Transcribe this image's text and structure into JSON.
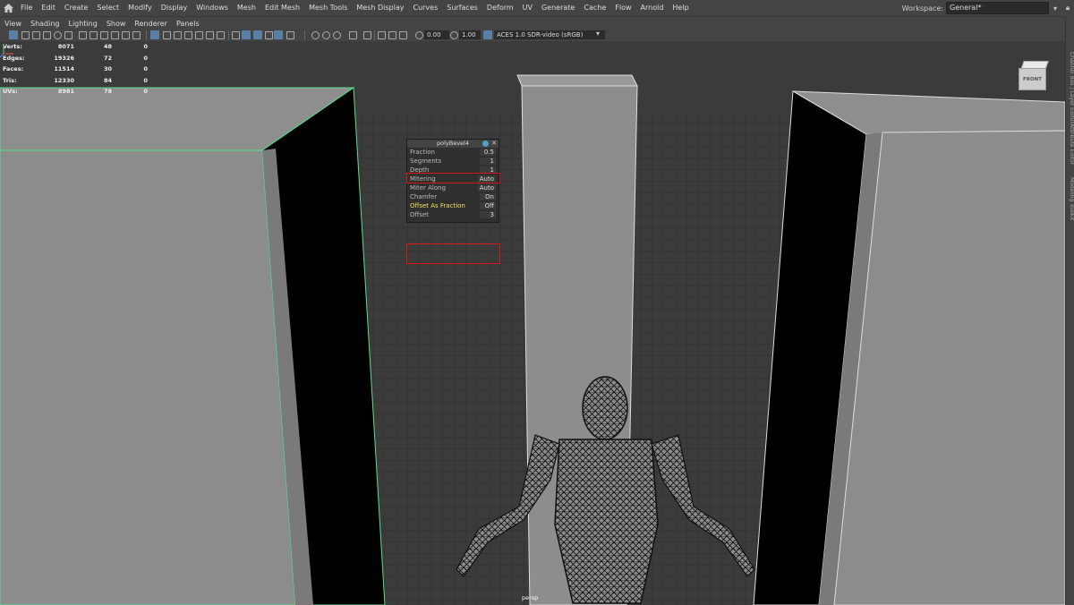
{
  "menubar": {
    "items": [
      "File",
      "Edit",
      "Create",
      "Select",
      "Modify",
      "Display",
      "Windows",
      "Mesh",
      "Edit Mesh",
      "Mesh Tools",
      "Mesh Display",
      "Curves",
      "Surfaces",
      "Deform",
      "UV",
      "Generate",
      "Cache",
      "Flow",
      "Arnold",
      "Help"
    ],
    "workspace_label": "Workspace:",
    "workspace_value": "General*"
  },
  "panel_menu": [
    "View",
    "Shading",
    "Lighting",
    "Show",
    "Renderer",
    "Panels"
  ],
  "toolbar": {
    "exposure": "0.00",
    "gamma": "1.00",
    "color_space": "ACES 1.0 SDR-video (sRGB)"
  },
  "hud": [
    {
      "label": "Verts:",
      "a": "8071",
      "b": "48",
      "c": "0"
    },
    {
      "label": "Edges:",
      "a": "19326",
      "b": "72",
      "c": "0"
    },
    {
      "label": "Faces:",
      "a": "11514",
      "b": "30",
      "c": "0"
    },
    {
      "label": "Tris:",
      "a": "12330",
      "b": "84",
      "c": "0"
    },
    {
      "label": "UVs:",
      "a": "8981",
      "b": "78",
      "c": "0"
    }
  ],
  "view_cube": {
    "face_label": "FRONT"
  },
  "camera_label": "persp",
  "popup": {
    "title": "polyBevel4",
    "rows": [
      {
        "label": "Fraction",
        "value": "0.5"
      },
      {
        "label": "Segments",
        "value": "1"
      },
      {
        "label": "Depth",
        "value": "1"
      },
      {
        "label": "Mitering",
        "value": "Auto"
      },
      {
        "label": "Miter Along",
        "value": "Auto"
      },
      {
        "label": "Chamfer",
        "value": "On"
      },
      {
        "label": "Offset As Fraction",
        "value": "Off"
      },
      {
        "label": "Offset",
        "value": "3"
      }
    ]
  },
  "right_tabs": [
    "Channel Box / Layer Editor",
    "Attribute Editor",
    "Modeling Toolkit"
  ],
  "colors": {
    "selection_outline": "#55e28a",
    "highlight_box": "#d21a1a",
    "highlight_text": "#f2e35a"
  }
}
